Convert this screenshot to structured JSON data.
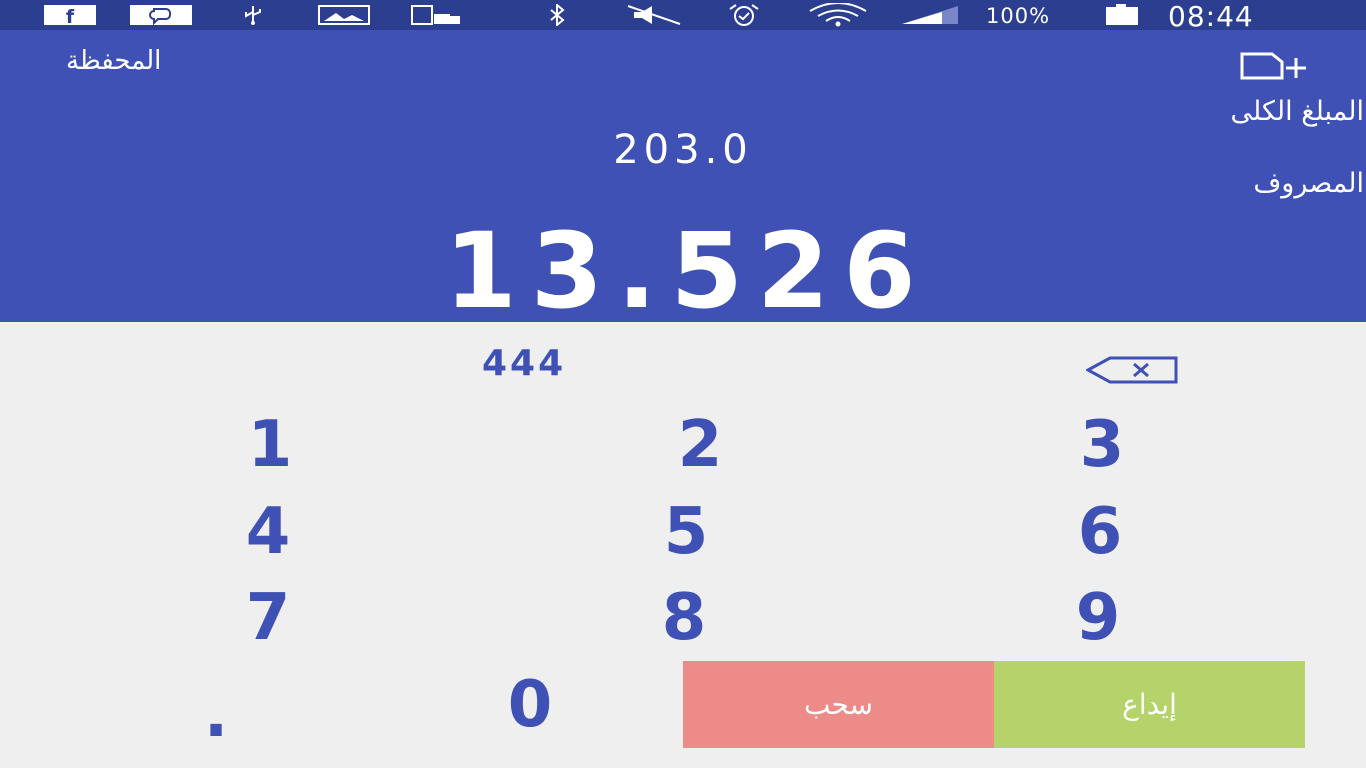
{
  "status_bar": {
    "battery": "100%",
    "time": "08:44",
    "icons": [
      "facebook-icon",
      "chat-icon",
      "usb-icon",
      "image-icon",
      "device-lock-icon",
      "bluetooth-icon",
      "mute-icon",
      "alarm-icon",
      "wifi-icon",
      "signal-icon",
      "battery-icon"
    ]
  },
  "header": {
    "title": "المحفظة",
    "total_label": "المبلغ الكلى",
    "total_value": "203.0",
    "spent_label": "المصروف",
    "spent_value": "13.526",
    "add_icon": "document-add-icon",
    "color": "#3f51b5"
  },
  "keypad": {
    "display": "444",
    "keys": [
      "1",
      "2",
      "3",
      "4",
      "5",
      "6",
      "7",
      "8",
      "9",
      ".",
      "0"
    ],
    "backspace_icon": "backspace-icon",
    "key_color": "#3f51b5"
  },
  "actions": {
    "withdraw_label": "سحب",
    "deposit_label": "إيداع",
    "withdraw_color": "#ec8b87",
    "deposit_color": "#b5d36a"
  }
}
